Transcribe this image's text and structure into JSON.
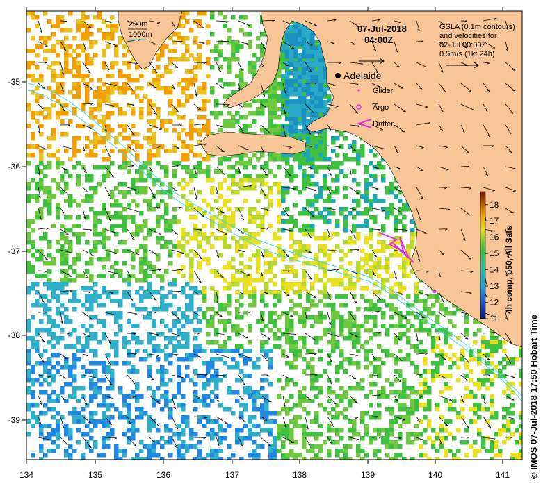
{
  "header": {
    "date": "07-Jul-2018",
    "time": "04:00Z"
  },
  "legend_top_left": {
    "contour_200m": "200m",
    "contour_1000m": "1000m"
  },
  "gsla_note": {
    "line1": "GSLA (0.1m contours)",
    "line2": "and velocities for",
    "line3": "02-Jul 00:00Z",
    "line4": "0.5m/s (1kt 24h)"
  },
  "platform_legend": {
    "place": "Adelaide",
    "glider": "Glider",
    "argo": "Argo",
    "drifter": "Drifter"
  },
  "colorbar": {
    "label": "4h comp, p50, All Sats",
    "ticks": [
      "18",
      "17",
      "16",
      "15",
      "14",
      "13",
      "12",
      "11"
    ],
    "min": 11,
    "max": 18.8
  },
  "axes": {
    "x_ticks": [
      "134",
      "135",
      "136",
      "137",
      "138",
      "139",
      "140",
      "141"
    ],
    "y_ticks": [
      "-35",
      "-36",
      "-37",
      "-38",
      "-39"
    ]
  },
  "credit": "© IMOS 07-Jul-2018 17:50 Hobart Time",
  "colors": {
    "land": "#f8c596",
    "contour": "#40d8e8",
    "marker": "#e030e0",
    "sst_warm": "#f0a000",
    "sst_mid": "#e8e020",
    "sst_green": "#40c040",
    "sst_cyan": "#30b0c8",
    "sst_blue": "#2088e0"
  }
}
